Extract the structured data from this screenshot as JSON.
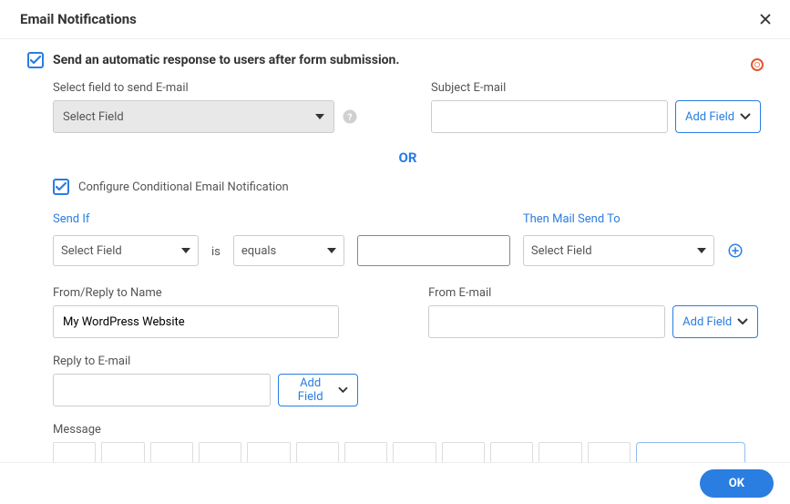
{
  "header": {
    "title": "Email Notifications"
  },
  "mainCheckbox": {
    "label": "Send an automatic response to users after form submission."
  },
  "fieldToSend": {
    "label": "Select field to send E-mail",
    "placeholder": "Select Field"
  },
  "subject": {
    "label": "Subject E-mail",
    "addFieldLabel": "Add Field"
  },
  "orDivider": "OR",
  "conditionalCheckbox": {
    "label": "Configure Conditional Email Notification"
  },
  "condition": {
    "sendIfLabel": "Send If",
    "thenLabel": "Then Mail Send To",
    "selectPlaceholder": "Select Field",
    "isLabel": "is",
    "operatorValue": "equals",
    "conditionValue": ""
  },
  "fromReply": {
    "label": "From/Reply to Name",
    "value": "My WordPress Website"
  },
  "fromEmail": {
    "label": "From E-mail",
    "addFieldLabel": "Add Field"
  },
  "replyEmail": {
    "label": "Reply to E-mail",
    "addFieldLabel": "Add Field"
  },
  "message": {
    "label": "Message"
  },
  "footer": {
    "okLabel": "OK"
  }
}
